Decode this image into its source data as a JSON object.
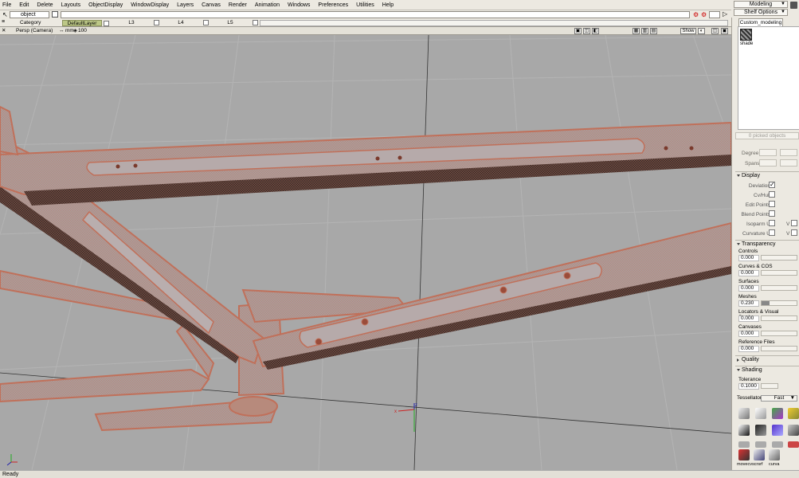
{
  "menu": [
    "File",
    "Edit",
    "Delete",
    "Layouts",
    "ObjectDisplay",
    "WindowDisplay",
    "Layers",
    "Canvas",
    "Render",
    "Animation",
    "Windows",
    "Preferences",
    "Utilities",
    "Help"
  ],
  "top_right": {
    "menu_set": "Modeling",
    "shelf_options": "Shelf Options"
  },
  "pick": {
    "mode": "object"
  },
  "layers": {
    "category_label": "Category",
    "items": [
      "DefaultLayer",
      "L3",
      "L4",
      "L5"
    ]
  },
  "viewport": {
    "title": "Persp (Camera)",
    "units": "mm",
    "zoom": "100",
    "show_label": "Show"
  },
  "shelf": {
    "tab": "Custom_modeling",
    "item_label": "shade"
  },
  "panel": {
    "picked_objects": "0 picked objects",
    "degree_label": "Degree",
    "spans_label": "Spans",
    "display": {
      "title": "Display",
      "deviation": "Deviation",
      "cvhull": "Cv/Hull",
      "edit_points": "Edit Points",
      "blend_points": "Blend Points",
      "isoparm_u": "Isoparm U",
      "curvature_u": "Curvature U",
      "v_label": "V"
    },
    "transparency": {
      "title": "Transparency",
      "controls": "Controls",
      "controls_val": "0.000",
      "curves": "Curves & COS",
      "curves_val": "0.000",
      "surfaces": "Surfaces",
      "surfaces_val": "0.000",
      "meshes": "Meshes",
      "meshes_val": "0.230",
      "locators": "Locators & Visual Sections",
      "locators_val": "0.000",
      "canvases": "Canvases",
      "canvases_val": "0.000",
      "reference": "Reference Files",
      "reference_val": "0.000"
    },
    "quality_title": "Quality",
    "shading": {
      "title": "Shading",
      "tolerance": "Tolerance",
      "tolerance_val": "0.1000",
      "tessellator": "Tessellator",
      "tessellator_val": "Fast"
    },
    "tools": [
      "movecv",
      "scrsrf",
      "curva"
    ]
  },
  "status": "Ready",
  "colors": {
    "viewport_bg": "#a8a8a8",
    "mesh": "#b86a55",
    "layer_default": "#bcc786"
  }
}
